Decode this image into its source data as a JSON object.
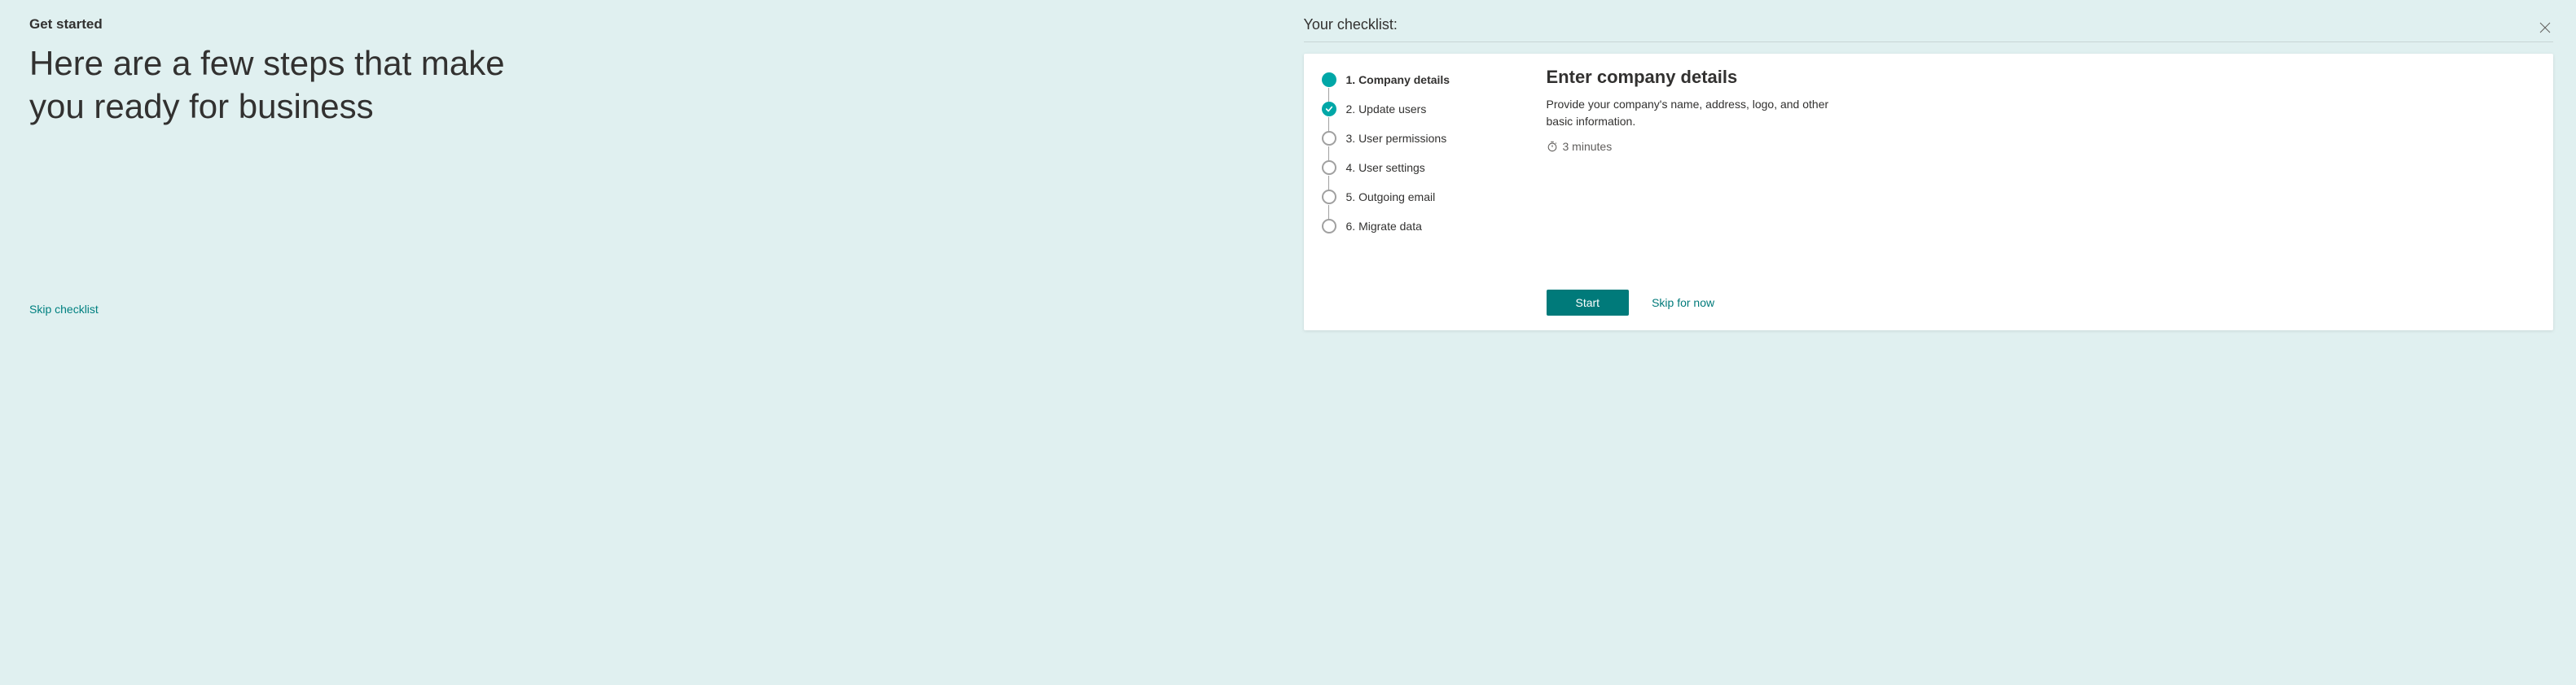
{
  "left": {
    "kicker": "Get started",
    "heading": "Here are a few steps that make you ready for business",
    "skip_link": "Skip checklist"
  },
  "right": {
    "checklist_label": "Your checklist:",
    "steps": [
      {
        "num": "1.",
        "label": "Company details",
        "state": "current"
      },
      {
        "num": "2.",
        "label": "Update users",
        "state": "done"
      },
      {
        "num": "3.",
        "label": "User permissions",
        "state": "pending"
      },
      {
        "num": "4.",
        "label": "User settings",
        "state": "pending"
      },
      {
        "num": "5.",
        "label": "Outgoing email",
        "state": "pending"
      },
      {
        "num": "6.",
        "label": "Migrate data",
        "state": "pending"
      }
    ],
    "detail": {
      "heading": "Enter company details",
      "description": "Provide your company's name, address, logo, and other basic information.",
      "duration": "3 minutes",
      "start": "Start",
      "skip": "Skip for now"
    }
  },
  "colors": {
    "teal": "#00a7a7",
    "teal_dark": "#007a7a",
    "bg": "#e0f0f0"
  }
}
